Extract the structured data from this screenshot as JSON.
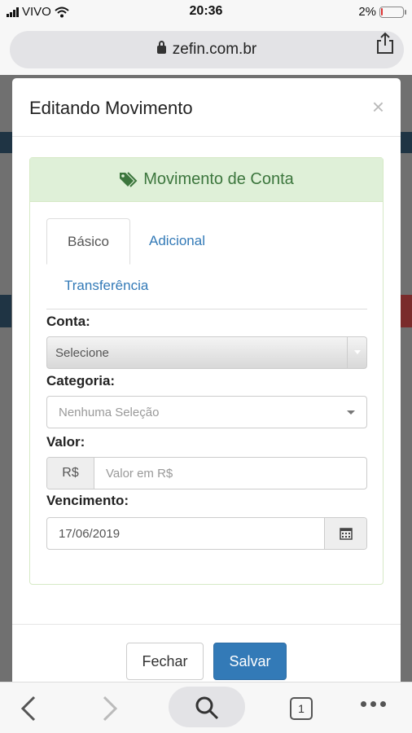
{
  "status_bar": {
    "carrier": "VIVO",
    "time": "20:36",
    "battery": "2%"
  },
  "browser": {
    "url": "zefin.com.br",
    "open_tabs": "1"
  },
  "modal": {
    "title": "Editando Movimento",
    "close": "×",
    "panel_title": "Movimento de Conta",
    "tabs": [
      {
        "label": "Básico",
        "active": true
      },
      {
        "label": "Adicional",
        "active": false
      },
      {
        "label": "Transferência",
        "active": false
      }
    ],
    "fields": {
      "conta": {
        "label": "Conta:",
        "value": "Selecione"
      },
      "categoria": {
        "label": "Categoria:",
        "placeholder": "Nenhuma Seleção"
      },
      "valor": {
        "label": "Valor:",
        "addon": "R$",
        "placeholder": "Valor em R$"
      },
      "vencimento": {
        "label": "Vencimento:",
        "value": "17/06/2019"
      }
    },
    "buttons": {
      "close": "Fechar",
      "save": "Salvar"
    }
  },
  "colors": {
    "primary": "#337ab7",
    "success_bg": "#dff0d8",
    "success_text": "#3c763d"
  }
}
